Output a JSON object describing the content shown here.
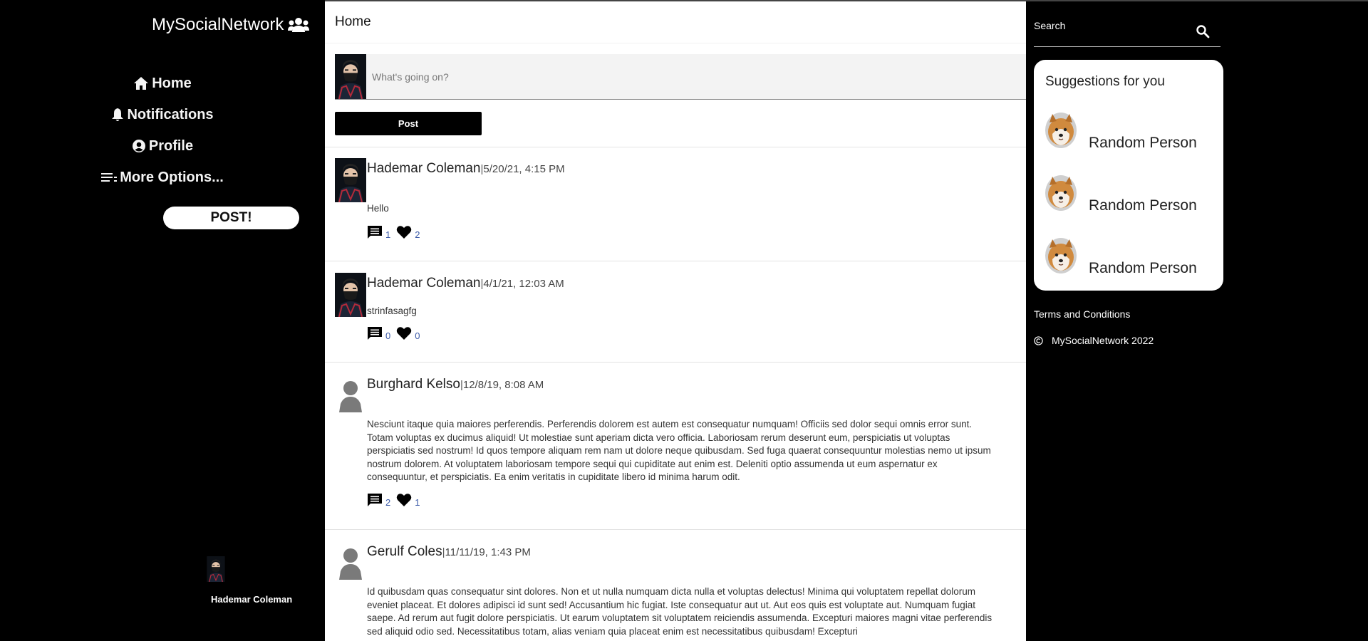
{
  "brand": {
    "name": "MySocialNetwork",
    "icon": "users-icon"
  },
  "nav": {
    "items": [
      {
        "label": "Home",
        "icon": "home-icon"
      },
      {
        "label": "Notifications",
        "icon": "bell-icon"
      },
      {
        "label": "Profile",
        "icon": "user-circle-icon"
      },
      {
        "label": "More Options...",
        "icon": "list-icon"
      }
    ],
    "post_label": "POST!"
  },
  "current_user": {
    "name": "Hademar Coleman"
  },
  "main": {
    "title": "Home",
    "composer": {
      "placeholder": "What's going on?",
      "value": ""
    },
    "post_button": "Post",
    "posts": [
      {
        "author": "Hademar Coleman",
        "separator": "|",
        "date": "5/20/21, 4:15 PM",
        "body": "Hello",
        "comments": "1",
        "likes": "2"
      },
      {
        "author": "Hademar Coleman",
        "separator": "|",
        "date": "4/1/21, 12:03 AM",
        "body": "strinfasagfg",
        "comments": "0",
        "likes": "0"
      },
      {
        "author": "Burghard Kelso",
        "separator": "|",
        "date": "12/8/19, 8:08 AM",
        "body": "Nesciunt itaque quia maiores perferendis. Perferendis dolorem est autem est consequatur numquam! Officiis sed dolor sequi omnis error sunt. Totam voluptas ex ducimus aliquid! Ut molestiae sunt aperiam dicta vero officia. Laboriosam rerum deserunt eum, perspiciatis ut voluptas perspiciatis sed nostrum! Id quos tempore aliquam rem nam ut dolore neque quibusdam. Sed fuga quaerat consequuntur molestias nemo ut ipsum nostrum dolorem. At voluptatem laboriosam tempore sequi qui cupiditate aut enim est. Deleniti optio assumenda ut eum aspernatur ex consequuntur, et perspiciatis. Ea enim veritatis in cupiditate libero id minima harum odit.",
        "comments": "2",
        "likes": "1"
      },
      {
        "author": "Gerulf Coles",
        "separator": "|",
        "date": "11/11/19, 1:43 PM",
        "body": "Id quibusdam quas consequatur sint dolores. Non et ut nulla numquam dicta nulla et voluptas delectus! Minima qui voluptatem repellat dolorum eveniet placeat. Et dolores adipisci id sunt sed! Accusantium hic fugiat. Iste consequatur aut ut. Aut eos quis est voluptate aut. Numquam fugiat saepe. Ad rerum aut fugit dolore perspiciatis. Ut earum voluptatem sit voluptatem reiciendis assumenda. Excepturi maiores magni vitae perferendis sed aliquid odio sed. Necessitatibus totam, alias veniam quia placeat enim est necessitatibus quibusdam! Excepturi",
        "comments": "",
        "likes": ""
      }
    ]
  },
  "right": {
    "search": {
      "placeholder": "Search",
      "value": "",
      "icon": "search-icon"
    },
    "suggestions_title": "Suggestions for you",
    "suggestions": [
      {
        "name": "Random Person"
      },
      {
        "name": "Random Person"
      },
      {
        "name": "Random Person"
      }
    ],
    "terms": "Terms and Conditions",
    "copyright": "MySocialNetwork 2022",
    "copyright_icon": "copyright-icon"
  },
  "colors": {
    "sidebar_bg": "#000000",
    "content_bg": "#ffffff",
    "count_color": "#3b5aa8"
  }
}
